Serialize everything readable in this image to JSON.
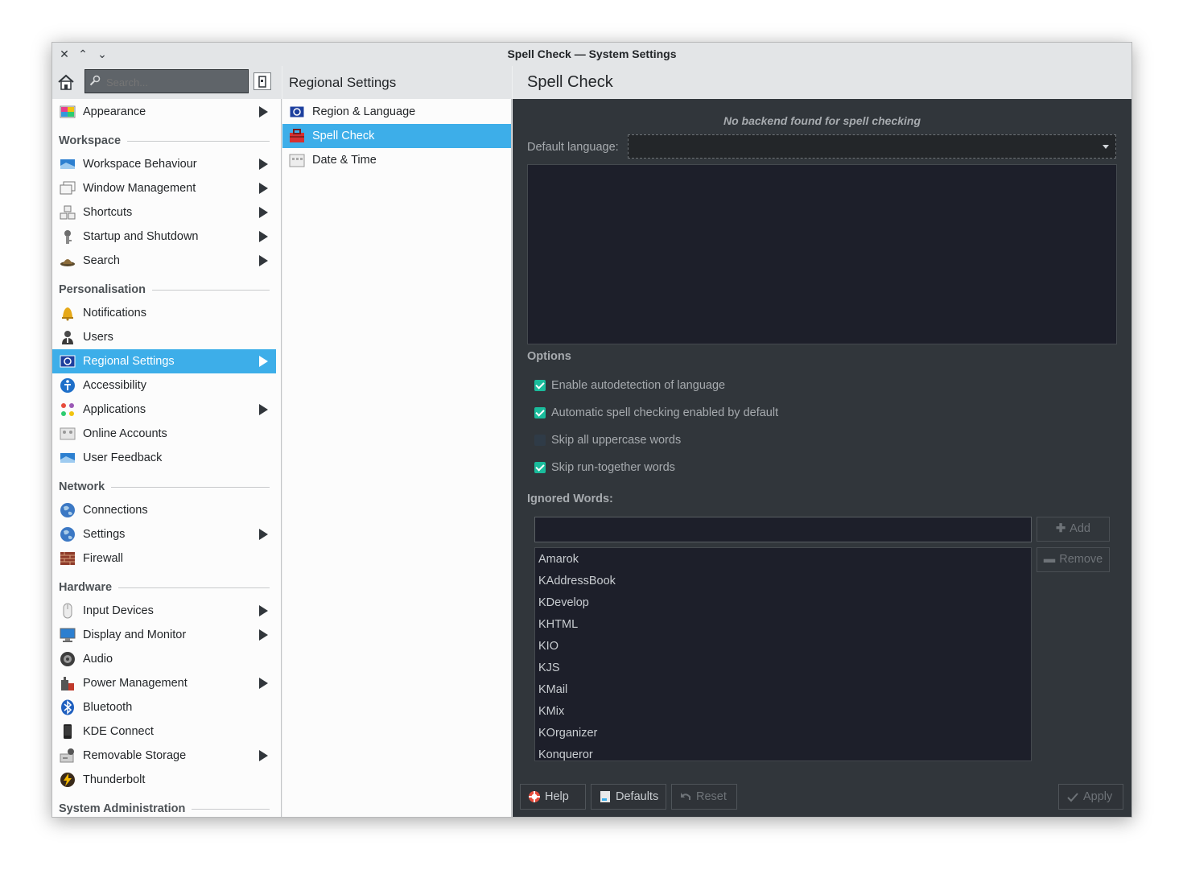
{
  "window": {
    "title": "Spell Check — System Settings"
  },
  "titlebar": {
    "close_glyph": "✕",
    "maximize_glyph": "⌃",
    "minimize_glyph": "⌄"
  },
  "search": {
    "placeholder": "Search..."
  },
  "sidebar": {
    "top_item": {
      "label": "Appearance",
      "icon": "appearance-icon",
      "has_arrow": true
    },
    "sections": [
      {
        "title": "Workspace",
        "items": [
          {
            "label": "Workspace Behaviour",
            "icon": "workspace-icon",
            "has_arrow": true
          },
          {
            "label": "Window Management",
            "icon": "window-icon",
            "has_arrow": true
          },
          {
            "label": "Shortcuts",
            "icon": "shortcuts-icon",
            "has_arrow": true
          },
          {
            "label": "Startup and Shutdown",
            "icon": "startup-icon",
            "has_arrow": true
          },
          {
            "label": "Search",
            "icon": "search-hat-icon",
            "has_arrow": true
          }
        ]
      },
      {
        "title": "Personalisation",
        "items": [
          {
            "label": "Notifications",
            "icon": "bell-icon",
            "has_arrow": false
          },
          {
            "label": "Users",
            "icon": "user-icon",
            "has_arrow": false
          },
          {
            "label": "Regional Settings",
            "icon": "flag-icon",
            "has_arrow": true,
            "selected": true
          },
          {
            "label": "Accessibility",
            "icon": "accessibility-icon",
            "has_arrow": false
          },
          {
            "label": "Applications",
            "icon": "applications-icon",
            "has_arrow": true
          },
          {
            "label": "Online Accounts",
            "icon": "online-accounts-icon",
            "has_arrow": false
          },
          {
            "label": "User Feedback",
            "icon": "feedback-icon",
            "has_arrow": false
          }
        ]
      },
      {
        "title": "Network",
        "items": [
          {
            "label": "Connections",
            "icon": "globe-icon",
            "has_arrow": false
          },
          {
            "label": "Settings",
            "icon": "globe-icon",
            "has_arrow": true
          },
          {
            "label": "Firewall",
            "icon": "firewall-icon",
            "has_arrow": false
          }
        ]
      },
      {
        "title": "Hardware",
        "items": [
          {
            "label": "Input Devices",
            "icon": "mouse-icon",
            "has_arrow": true
          },
          {
            "label": "Display and Monitor",
            "icon": "monitor-icon",
            "has_arrow": true
          },
          {
            "label": "Audio",
            "icon": "speaker-icon",
            "has_arrow": false
          },
          {
            "label": "Power Management",
            "icon": "power-icon",
            "has_arrow": true
          },
          {
            "label": "Bluetooth",
            "icon": "bluetooth-icon",
            "has_arrow": false
          },
          {
            "label": "KDE Connect",
            "icon": "phone-icon",
            "has_arrow": false
          },
          {
            "label": "Removable Storage",
            "icon": "storage-icon",
            "has_arrow": true
          },
          {
            "label": "Thunderbolt",
            "icon": "thunderbolt-icon",
            "has_arrow": false
          }
        ]
      },
      {
        "title": "System Administration",
        "items": []
      }
    ]
  },
  "middle": {
    "title": "Regional Settings",
    "items": [
      {
        "label": "Region & Language",
        "icon": "flag-icon"
      },
      {
        "label": "Spell Check",
        "icon": "toolbox-icon",
        "selected": true
      },
      {
        "label": "Date & Time",
        "icon": "calendar-icon"
      }
    ]
  },
  "page": {
    "title": "Spell Check",
    "warning": "No backend found for spell checking",
    "default_language_label": "Default language:",
    "default_language_value": "",
    "options_title": "Options",
    "options": [
      {
        "label": "Enable autodetection of language",
        "checked": true
      },
      {
        "label": "Automatic spell checking enabled by default",
        "checked": true
      },
      {
        "label": "Skip all uppercase words",
        "checked": false
      },
      {
        "label": "Skip run-together words",
        "checked": true
      }
    ],
    "ignored_title": "Ignored Words:",
    "ignored_input_value": "",
    "add_label": "Add",
    "remove_label": "Remove",
    "ignored_words": [
      "Amarok",
      "KAddressBook",
      "KDevelop",
      "KHTML",
      "KIO",
      "KJS",
      "KMail",
      "KMix",
      "KOrganizer",
      "Konqueror"
    ]
  },
  "footer": {
    "help": "Help",
    "defaults": "Defaults",
    "reset": "Reset",
    "apply": "Apply"
  },
  "colors": {
    "selection": "#3daee9",
    "content_bg": "#31363b",
    "checkbox_on": "#1abc9c"
  }
}
